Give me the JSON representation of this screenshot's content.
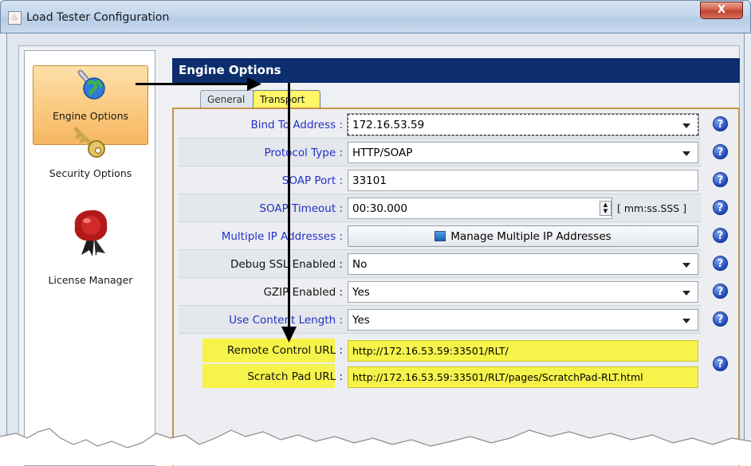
{
  "window": {
    "title": "Load Tester Configuration",
    "close_label": "X",
    "app_icon": "java-app-icon"
  },
  "sidebar": {
    "items": [
      {
        "label": "Engine Options",
        "icon": "globe-network-icon",
        "selected": true
      },
      {
        "label": "Security Options",
        "icon": "key-icon",
        "selected": false
      },
      {
        "label": "License Manager",
        "icon": "wax-seal-icon",
        "selected": false
      }
    ]
  },
  "panel": {
    "title": "Engine Options",
    "tabs": [
      {
        "label": "General",
        "selected": false
      },
      {
        "label": "Transport",
        "selected": true
      }
    ]
  },
  "form": {
    "bind_to_address": {
      "label": "Bind To Address :",
      "value": "172.16.53.59"
    },
    "protocol_type": {
      "label": "Protocol Type :",
      "value": "HTTP/SOAP"
    },
    "soap_port": {
      "label": "SOAP Port :",
      "value": "33101"
    },
    "soap_timeout": {
      "label": "SOAP Timeout :",
      "value": "00:30.000",
      "unit": "[ mm:ss.SSS ]"
    },
    "multiple_ip": {
      "label": "Multiple IP Addresses :",
      "button": "Manage Multiple IP Addresses"
    },
    "debug_ssl": {
      "label": "Debug SSL Enabled :",
      "value": "No"
    },
    "gzip": {
      "label": "GZIP Enabled :",
      "value": "Yes"
    },
    "content_length": {
      "label": "Use Content Length :",
      "value": "Yes"
    },
    "remote_control_url": {
      "label": "Remote Control URL :",
      "value": "http://172.16.53.59:33501/RLT/"
    },
    "scratch_pad_url": {
      "label": "Scratch Pad URL :",
      "value": "http://172.16.53.59:33501/RLT/pages/ScratchPad-RLT.html"
    },
    "help_glyph": "?"
  },
  "colors": {
    "header": "#0d2e6d",
    "highlight": "#f6f34a",
    "label_blue": "#2230c8",
    "selected_nav": "#f6b760"
  }
}
